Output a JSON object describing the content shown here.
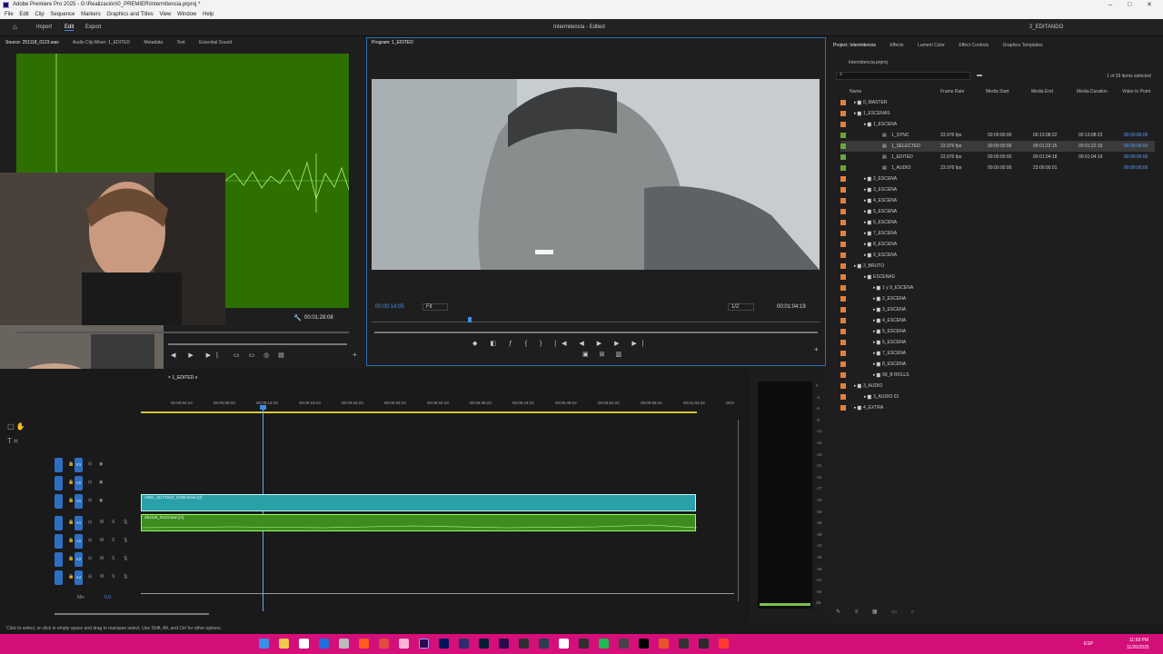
{
  "window": {
    "title": "Adobe Premiere Pro 2025 - G:\\Realización\\0_PREMIER\\Intermitencia.prproj *"
  },
  "menu": [
    "File",
    "Edit",
    "Clip",
    "Sequence",
    "Markers",
    "Graphics and Titles",
    "View",
    "Window",
    "Help"
  ],
  "workspace": {
    "tabs": [
      "Import",
      "Edit",
      "Export"
    ],
    "active": "Edit",
    "doc_title": "Intermitencia - Edited",
    "user": "2_EDITANDO"
  },
  "source": {
    "tabs": [
      "Source: 251118_0123.wav",
      "Audio Clip Mixer: 1_EDITED",
      "Metadata",
      "Text",
      "Essential Sound"
    ],
    "timecode": "00:01:28:08"
  },
  "program": {
    "title": "Program: 1_EDITED",
    "timecode": "00:00:14:05",
    "fit": "Fit",
    "res": "1/2",
    "duration": "00:01:04:19"
  },
  "timeline": {
    "name": "1_EDITED",
    "ruler": [
      "00:00:04:23",
      "00:00:09:23",
      "00:00:14:23",
      "00:00:19:23",
      "00:00:24:23",
      "00:00:29:23",
      "00:00:34:23",
      "00:00:39:23",
      "00:00:44:22",
      "00:00:49:22",
      "00:00:54:22",
      "00:00:59:22",
      "00:01:04:22",
      "00:0"
    ],
    "video_tracks": [
      "V3",
      "V2",
      "V1"
    ],
    "audio_tracks": [
      "A1",
      "A2",
      "A3",
      "A4"
    ],
    "mix_label": "Mix",
    "mix_value": "0.0",
    "video_clip": "A001_11171522_C059.braw [V]",
    "audio_clip": "251118_0123.wav [A]"
  },
  "meter": {
    "ticks": [
      "0",
      "-3",
      "-6",
      "-9",
      "-12",
      "-15",
      "-18",
      "-21",
      "-24",
      "-27",
      "-30",
      "-33",
      "-36",
      "-39",
      "-42",
      "-45",
      "-48",
      "-51",
      "-54",
      "dB"
    ],
    "s": "S"
  },
  "project": {
    "tabs": [
      "Project: Intermitencia",
      "Effects",
      "Lumetri Color",
      "Effect Controls",
      "Graphics Templates"
    ],
    "file": "Intermitencia.prproj",
    "selection": "1 of 29 items selected",
    "columns": [
      "Name",
      "Frame Rate",
      "Media Start",
      "Media End",
      "Media Duration",
      "Video In Point"
    ],
    "rows": [
      {
        "name": "0_MASTER"
      },
      {
        "name": "1_ESCENAS"
      },
      {
        "name": "1_ESCENA"
      },
      {
        "name": "1_SYNC",
        "fps": "23.976 fps",
        "start": "00:00:00:00",
        "end": "00:13:08:22",
        "dur": "00:13:08:23",
        "vin": "00:00:00:00"
      },
      {
        "name": "1_SELECTED",
        "fps": "23.976 fps",
        "start": "00:00:00:00",
        "end": "00:01:22:15",
        "dur": "00:01:22:16",
        "vin": "00:00:00:00"
      },
      {
        "name": "1_EDITED",
        "fps": "23.976 fps",
        "start": "00:00:00:00",
        "end": "00:01:04:18",
        "dur": "00:01:04:19",
        "vin": "00:00:00:00"
      },
      {
        "name": "1_AUDIO",
        "fps": "23.976 fps",
        "start": "00:00:00:00",
        "end": "23:00:00:01",
        "dur": "",
        "vin": "00:00:00:00"
      },
      {
        "name": "2_ESCENA"
      },
      {
        "name": "3_ESCENA"
      },
      {
        "name": "4_ESCENA"
      },
      {
        "name": "5_ESCENA"
      },
      {
        "name": "6_ESCENA"
      },
      {
        "name": "7_ESCENA"
      },
      {
        "name": "8_ESCENA"
      },
      {
        "name": "9_ESCENA"
      },
      {
        "name": "2_BRUTO"
      },
      {
        "name": "ESCENAS"
      },
      {
        "name": "1 y 9_ESCENA"
      },
      {
        "name": "2_ESCENA"
      },
      {
        "name": "3_ESCENA"
      },
      {
        "name": "4_ESCENA"
      },
      {
        "name": "5_ESCENA"
      },
      {
        "name": "6_ESCENA"
      },
      {
        "name": "7_ESCENA"
      },
      {
        "name": "8_ESCENA"
      },
      {
        "name": "99_B ROLLS"
      },
      {
        "name": "3_AUDIO"
      },
      {
        "name": "3_AUDIO 01"
      },
      {
        "name": "4_EXTRA"
      }
    ]
  },
  "status": "Click to select, or click in empty space and drag to marquee select. Use Shift, Alt, and Ctrl for other options.",
  "taskbar": {
    "lang": "ESP",
    "time": "11:59 PM",
    "date": "11/20/2025"
  }
}
